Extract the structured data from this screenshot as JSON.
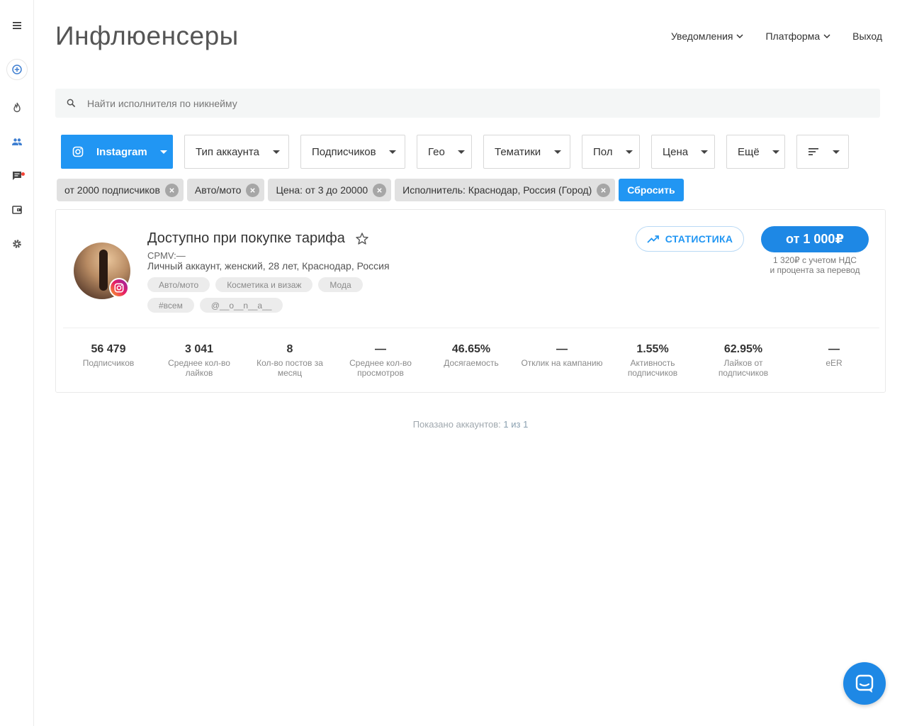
{
  "sidebar": {
    "items": [
      {
        "icon": "menu-icon"
      },
      {
        "icon": "add-circle-icon"
      },
      {
        "icon": "fire-icon"
      },
      {
        "icon": "people-icon"
      },
      {
        "icon": "chat-icon",
        "has_notification": true
      },
      {
        "icon": "wallet-icon"
      },
      {
        "icon": "gear-icon"
      }
    ]
  },
  "header": {
    "title": "Инфлюенсеры",
    "nav": {
      "notifications": "Уведомления",
      "platform": "Платформа",
      "logout": "Выход"
    }
  },
  "search": {
    "placeholder": "Найти исполнителя по никнейму",
    "value": ""
  },
  "filters": {
    "platform": "Instagram",
    "account_type": "Тип аккаунта",
    "followers": "Подписчиков",
    "geo": "Гео",
    "topics": "Тематики",
    "gender": "Пол",
    "price": "Цена",
    "more": "Ещё",
    "sort_icon": "sort-icon"
  },
  "active_filters": {
    "chips": [
      "от 2000 подписчиков",
      "Авто/мото",
      "Цена: от 3 до 20000",
      "Исполнитель: Краснодар, Россия (Город)"
    ],
    "reset_label": "Сбросить"
  },
  "card": {
    "title": "Доступно при покупке тарифа",
    "cpmv": "CPMV:—",
    "meta": "Личный аккаунт, женский, 28 лет, Краснодар, Россия",
    "tags": [
      "Авто/мото",
      "Косметика и визаж",
      "Мода",
      "#всем",
      "@__o__n__a__"
    ],
    "stats_button": "СТАТИСТИКА",
    "price_button": "от 1 000₽",
    "price_note_1": "1 320₽ с учетом НДС",
    "price_note_2": "и процента за перевод",
    "stats": [
      {
        "value": "56 479",
        "label": "Подписчиков"
      },
      {
        "value": "3 041",
        "label": "Среднее кол-во лайков"
      },
      {
        "value": "8",
        "label": "Кол-во постов за месяц"
      },
      {
        "value": "—",
        "label": "Среднее кол-во просмотров"
      },
      {
        "value": "46.65%",
        "label": "Досягаемость"
      },
      {
        "value": "—",
        "label": "Отклик на кампанию"
      },
      {
        "value": "1.55%",
        "label": "Активность подписчиков"
      },
      {
        "value": "62.95%",
        "label": "Лайков от подписчиков"
      },
      {
        "value": "—",
        "label": "eER"
      }
    ]
  },
  "footer": {
    "shown_prefix": "Показано аккаунтов:",
    "shown_count": "1 из 1"
  },
  "colors": {
    "accent": "#2196f3",
    "price": "#1e88e5",
    "chip_bg": "#e1e1e1"
  }
}
